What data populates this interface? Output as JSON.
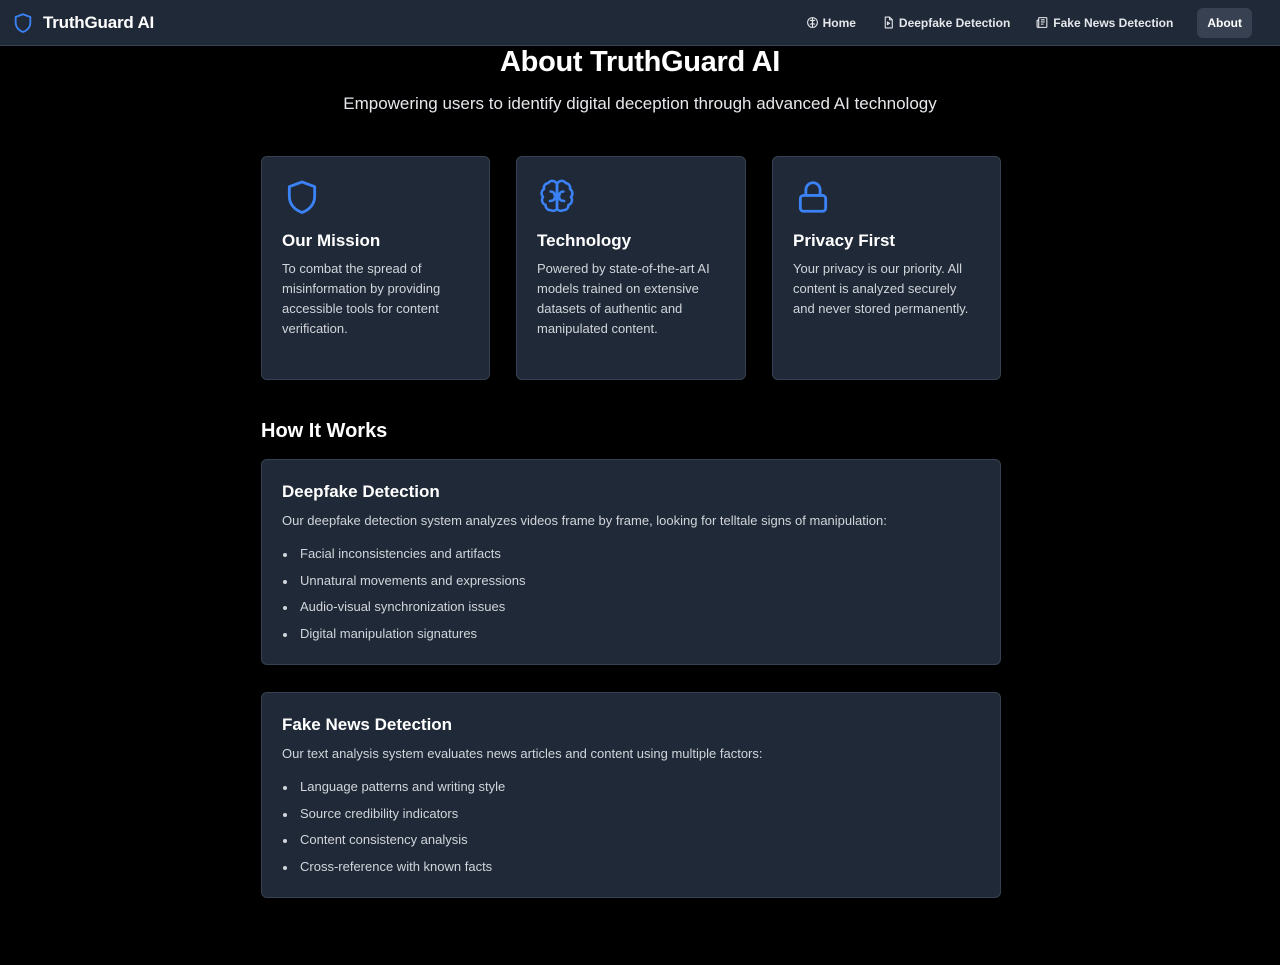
{
  "nav": {
    "brand": "TruthGuard AI",
    "links": [
      {
        "label": "Home",
        "icon": "brain-icon"
      },
      {
        "label": "Deepfake Detection",
        "icon": "file-video-icon"
      },
      {
        "label": "Fake News Detection",
        "icon": "newspaper-icon"
      },
      {
        "label": "About",
        "active": true
      }
    ]
  },
  "hero": {
    "title": "About TruthGuard AI",
    "subtitle": "Empowering users to identify digital deception through advanced AI technology"
  },
  "cards": [
    {
      "icon": "shield-icon",
      "title": "Our Mission",
      "text": "To combat the spread of misinformation by providing accessible tools for content verification."
    },
    {
      "icon": "brain-icon",
      "title": "Technology",
      "text": "Powered by state-of-the-art AI models trained on extensive datasets of authentic and manipulated content."
    },
    {
      "icon": "lock-icon",
      "title": "Privacy First",
      "text": "Your privacy is our priority. All content is analyzed securely and never stored permanently."
    }
  ],
  "how_it_works": {
    "heading": "How It Works",
    "sections": [
      {
        "title": "Deepfake Detection",
        "description": "Our deepfake detection system analyzes videos frame by frame, looking for telltale signs of manipulation:",
        "items": [
          "Facial inconsistencies and artifacts",
          "Unnatural movements and expressions",
          "Audio-visual synchronization issues",
          "Digital manipulation signatures"
        ]
      },
      {
        "title": "Fake News Detection",
        "description": "Our text analysis system evaluates news articles and content using multiple factors:",
        "items": [
          "Language patterns and writing style",
          "Source credibility indicators",
          "Content consistency analysis",
          "Cross-reference with known facts"
        ]
      }
    ]
  },
  "colors": {
    "accent": "#3b82f6",
    "background": "#000000",
    "surface": "#1f2937",
    "border": "#374151"
  }
}
